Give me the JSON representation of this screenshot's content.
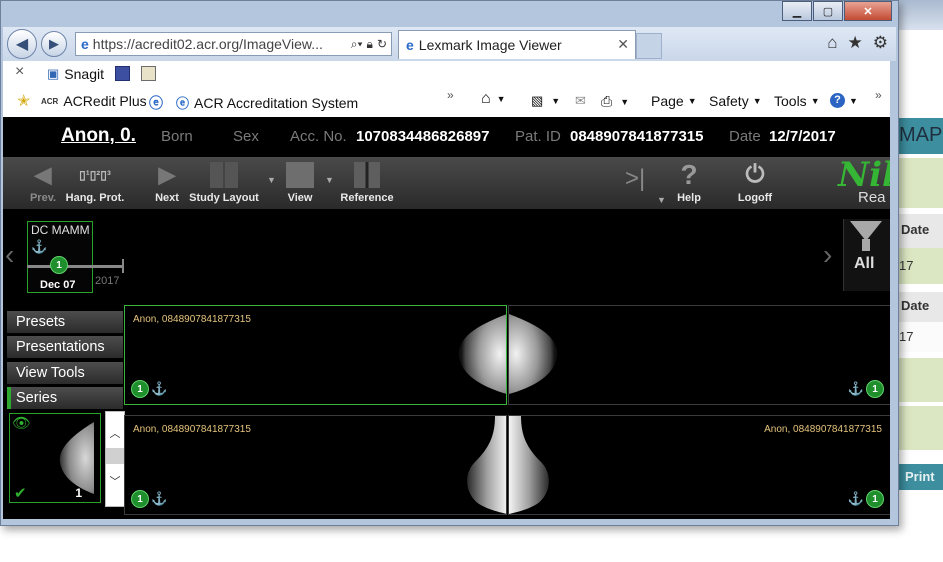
{
  "browser": {
    "address_url": "https://acredit02.acr.org/ImageView...",
    "tab_title": "Lexmark Image Viewer",
    "window_controls": [
      "minimize-icon",
      "maximize-icon",
      "close-icon"
    ],
    "toolbar_right_icons": [
      "home-icon",
      "star-icon",
      "gear-icon"
    ]
  },
  "favorites": {
    "row1": {
      "close": "×",
      "snagit": "Snagit"
    },
    "row2": {
      "acredit_plus": "ACRedit Plus",
      "acr_system": "ACR Accreditation System",
      "page": "Page",
      "safety": "Safety",
      "tools": "Tools",
      "help": "?"
    }
  },
  "patient": {
    "name": "Anon, 0.",
    "born_label": "Born",
    "sex_label": "Sex",
    "acc_label": "Acc. No.",
    "acc_value": "1070834486826897",
    "pat_label": "Pat. ID",
    "pat_value": "0848907841877315",
    "date_label": "Date",
    "date_value": "12/7/2017"
  },
  "toolbar": {
    "prev": "Prev.",
    "hang_prot": "Hang. Prot.",
    "next": "Next",
    "study_layout": "Study Layout",
    "view": "View",
    "reference": "Reference",
    "help": "Help",
    "logoff": "Logoff",
    "brand_1": "Nil",
    "brand_2": "Rea"
  },
  "timeline": {
    "modality": "DC MAMM",
    "study_number": "1",
    "date": "Dec 07",
    "year": "2017",
    "filter": "All"
  },
  "side_panel": {
    "presets": "Presets",
    "presentations": "Presentations",
    "view_tools": "View Tools",
    "series": "Series",
    "series_count": "1"
  },
  "tiles": {
    "label": "Anon, 0848907841877315",
    "badge": "1"
  },
  "background_page": {
    "map": "MAP",
    "date1": "Date",
    "v1": "17",
    "date2": "Date",
    "v2": "17",
    "print": "Print"
  },
  "colors": {
    "viewer_bg": "#000000",
    "accent_green": "#2ea82e",
    "label_yellow": "#e5c47c"
  }
}
